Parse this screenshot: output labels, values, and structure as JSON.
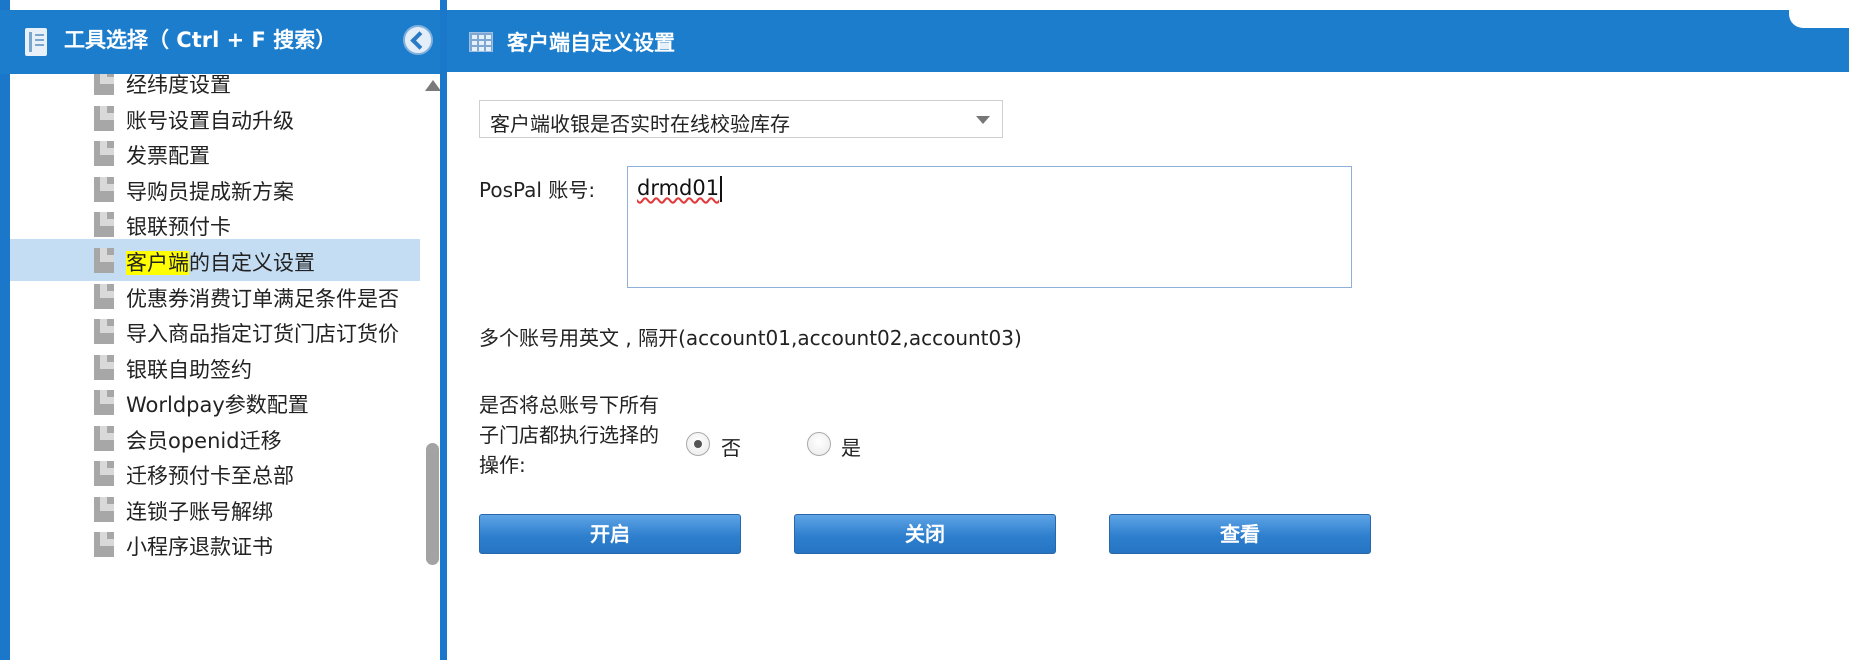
{
  "left_panel": {
    "title": "工具选择（ Ctrl + F 搜索）",
    "items": [
      {
        "label": "经纬度设置"
      },
      {
        "label": "账号设置自动升级"
      },
      {
        "label": "发票配置"
      },
      {
        "label": "导购员提成新方案"
      },
      {
        "label": "银联预付卡"
      },
      {
        "label_highlight": "客户端",
        "label_rest": "的自定义设置",
        "selected": true
      },
      {
        "label": "优惠券消费订单满足条件是否"
      },
      {
        "label": "导入商品指定订货门店订货价"
      },
      {
        "label": "银联自助签约"
      },
      {
        "label": "Worldpay参数配置"
      },
      {
        "label": "会员openid迁移"
      },
      {
        "label": "迁移预付卡至总部"
      },
      {
        "label": "连锁子账号解绑"
      },
      {
        "label": "小程序退款证书"
      }
    ]
  },
  "right_panel": {
    "title": "客户端自定义设置",
    "select": {
      "value": "客户端收银是否实时在线校验库存"
    },
    "account": {
      "label": "PosPal 账号:",
      "value": "drmd01"
    },
    "hint": "多个账号用英文 , 隔开(account01,account02,account03)",
    "question": "是否将总账号下所有子门店都执行选择的操作:",
    "radio": {
      "no": "否",
      "yes": "是",
      "selected": "no"
    },
    "buttons": {
      "on": "开启",
      "off": "关闭",
      "view": "查看"
    }
  },
  "colors": {
    "header_blue": "#1b7dcc",
    "selection_blue": "#c4ddf3",
    "highlight_yellow": "#ffff00"
  }
}
